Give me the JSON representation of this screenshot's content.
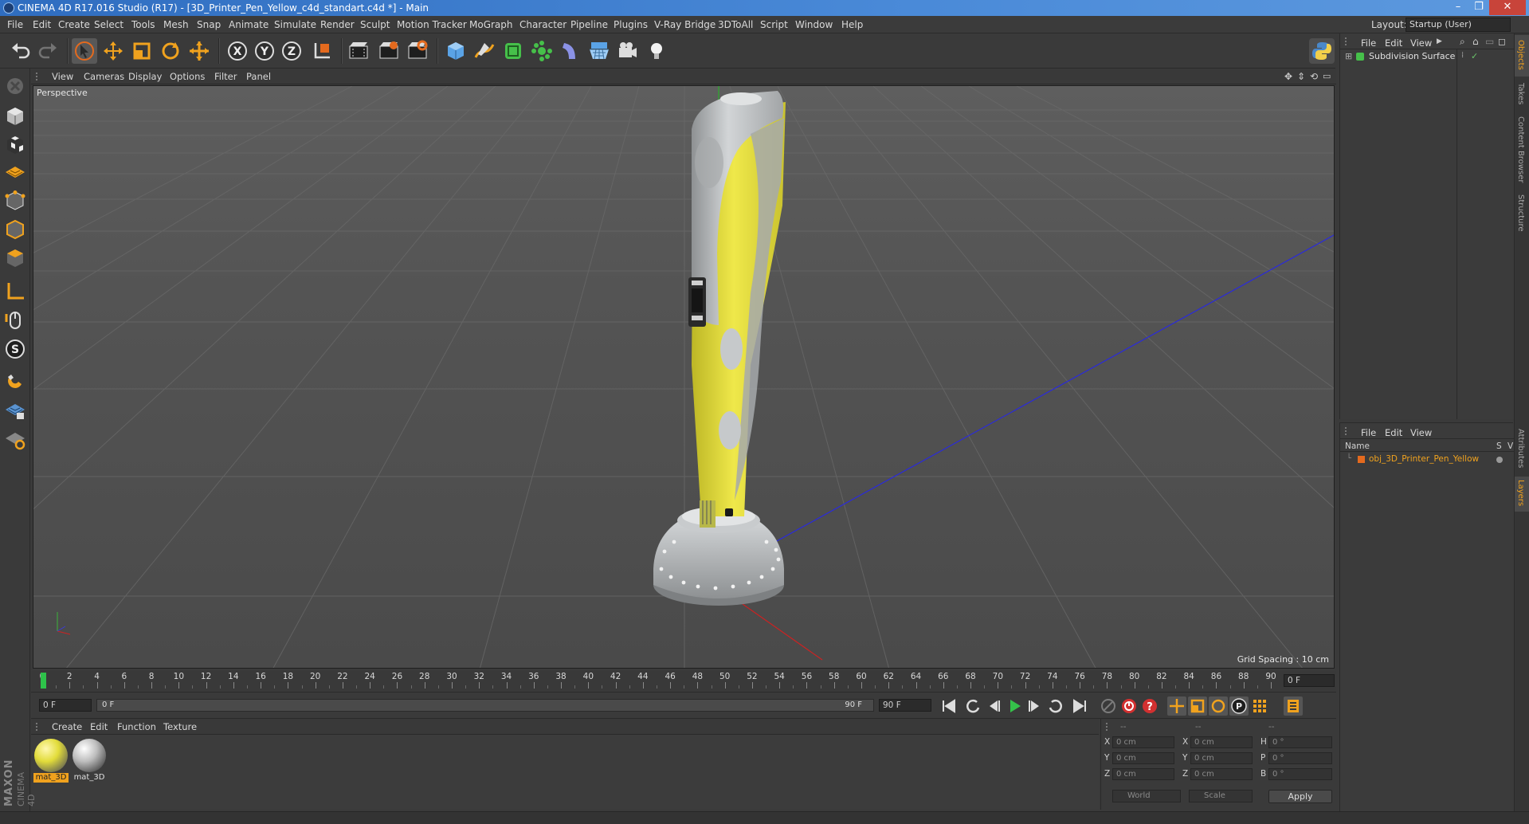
{
  "window": {
    "title": "CINEMA 4D R17.016 Studio (R17) - [3D_Printer_Pen_Yellow_c4d_standart.c4d *] - Main",
    "controls": [
      "–",
      "❐",
      "✕"
    ]
  },
  "menubar": {
    "items": [
      "File",
      "Edit",
      "Create",
      "Select",
      "Tools",
      "Mesh",
      "Snap",
      "Animate",
      "Simulate",
      "Render",
      "Sculpt",
      "Motion Tracker",
      "MoGraph",
      "Character",
      "Pipeline",
      "Plugins",
      "V-Ray Bridge",
      "3DToAll",
      "Script",
      "Window",
      "Help"
    ],
    "layout_label": "Layout:",
    "layout_value": "Startup (User)"
  },
  "toolbar": {
    "icons": [
      "undo-icon",
      "redo-icon",
      "select-arrow-icon",
      "move-icon",
      "scale-icon",
      "rotate-icon",
      "live-select-icon",
      "x-axis-icon",
      "y-axis-icon",
      "z-axis-icon",
      "coordinate-system-icon",
      "render-view-icon",
      "render-picture-viewer-icon",
      "edit-render-settings-icon",
      "cube-icon",
      "pen-spline-icon",
      "subdivision-icon",
      "array-icon",
      "deformer-icon",
      "floor-icon",
      "camera-icon",
      "light-icon",
      "python-icon"
    ]
  },
  "viewport": {
    "menu": [
      "View",
      "Cameras",
      "Display",
      "Options",
      "Filter",
      "Panel"
    ],
    "label": "Perspective",
    "grid_spacing": "Grid Spacing : 10 cm",
    "colors": {
      "pen_yellow": "#e8e23a",
      "pen_grey": "#b9bcbe",
      "base_grey": "#c4c7c9"
    }
  },
  "timeline": {
    "ticks": [
      "0",
      "2",
      "4",
      "6",
      "8",
      "10",
      "12",
      "14",
      "16",
      "18",
      "20",
      "22",
      "24",
      "26",
      "28",
      "30",
      "32",
      "34",
      "36",
      "38",
      "40",
      "42",
      "44",
      "46",
      "48",
      "50",
      "52",
      "54",
      "56",
      "58",
      "60",
      "62",
      "64",
      "66",
      "68",
      "70",
      "72",
      "74",
      "76",
      "78",
      "80",
      "82",
      "84",
      "86",
      "88",
      "90"
    ],
    "current_frame": "0 F"
  },
  "transport": {
    "start_field": "0 F",
    "slider_start": "0 F",
    "slider_end": "90 F",
    "end_field": "90 F"
  },
  "material_manager": {
    "menu": [
      "Create",
      "Edit",
      "Function",
      "Texture"
    ],
    "materials": [
      {
        "label": "mat_3D",
        "selected": true,
        "color": "#e2dc3a"
      },
      {
        "label": "mat_3D",
        "selected": false,
        "color": "#bdbdbd"
      }
    ],
    "brand_top": "MAXON",
    "brand_bottom": "CINEMA 4D"
  },
  "coordinates": {
    "header": [
      "--",
      "--",
      "--"
    ],
    "rows": [
      {
        "a": "X",
        "av": "0 cm",
        "b": "X",
        "bv": "0 cm",
        "c": "H",
        "cv": "0 °"
      },
      {
        "a": "Y",
        "av": "0 cm",
        "b": "Y",
        "bv": "0 cm",
        "c": "P",
        "cv": "0 °"
      },
      {
        "a": "Z",
        "av": "0 cm",
        "b": "Z",
        "bv": "0 cm",
        "c": "B",
        "cv": "0 °"
      }
    ],
    "mode_world": "World",
    "mode_scale": "Scale",
    "apply": "Apply"
  },
  "object_manager": {
    "menu": [
      "File",
      "Edit",
      "View"
    ],
    "item": "Subdivision Surface"
  },
  "layer_manager": {
    "menu": [
      "File",
      "Edit",
      "View"
    ],
    "col_name": "Name",
    "col_s": "S",
    "col_v": "V",
    "item": "obj_3D_Printer_Pen_Yellow"
  },
  "side_tabs": [
    "Objects",
    "Takes",
    "Content Browser",
    "Structure",
    "Attributes",
    "Layers"
  ]
}
